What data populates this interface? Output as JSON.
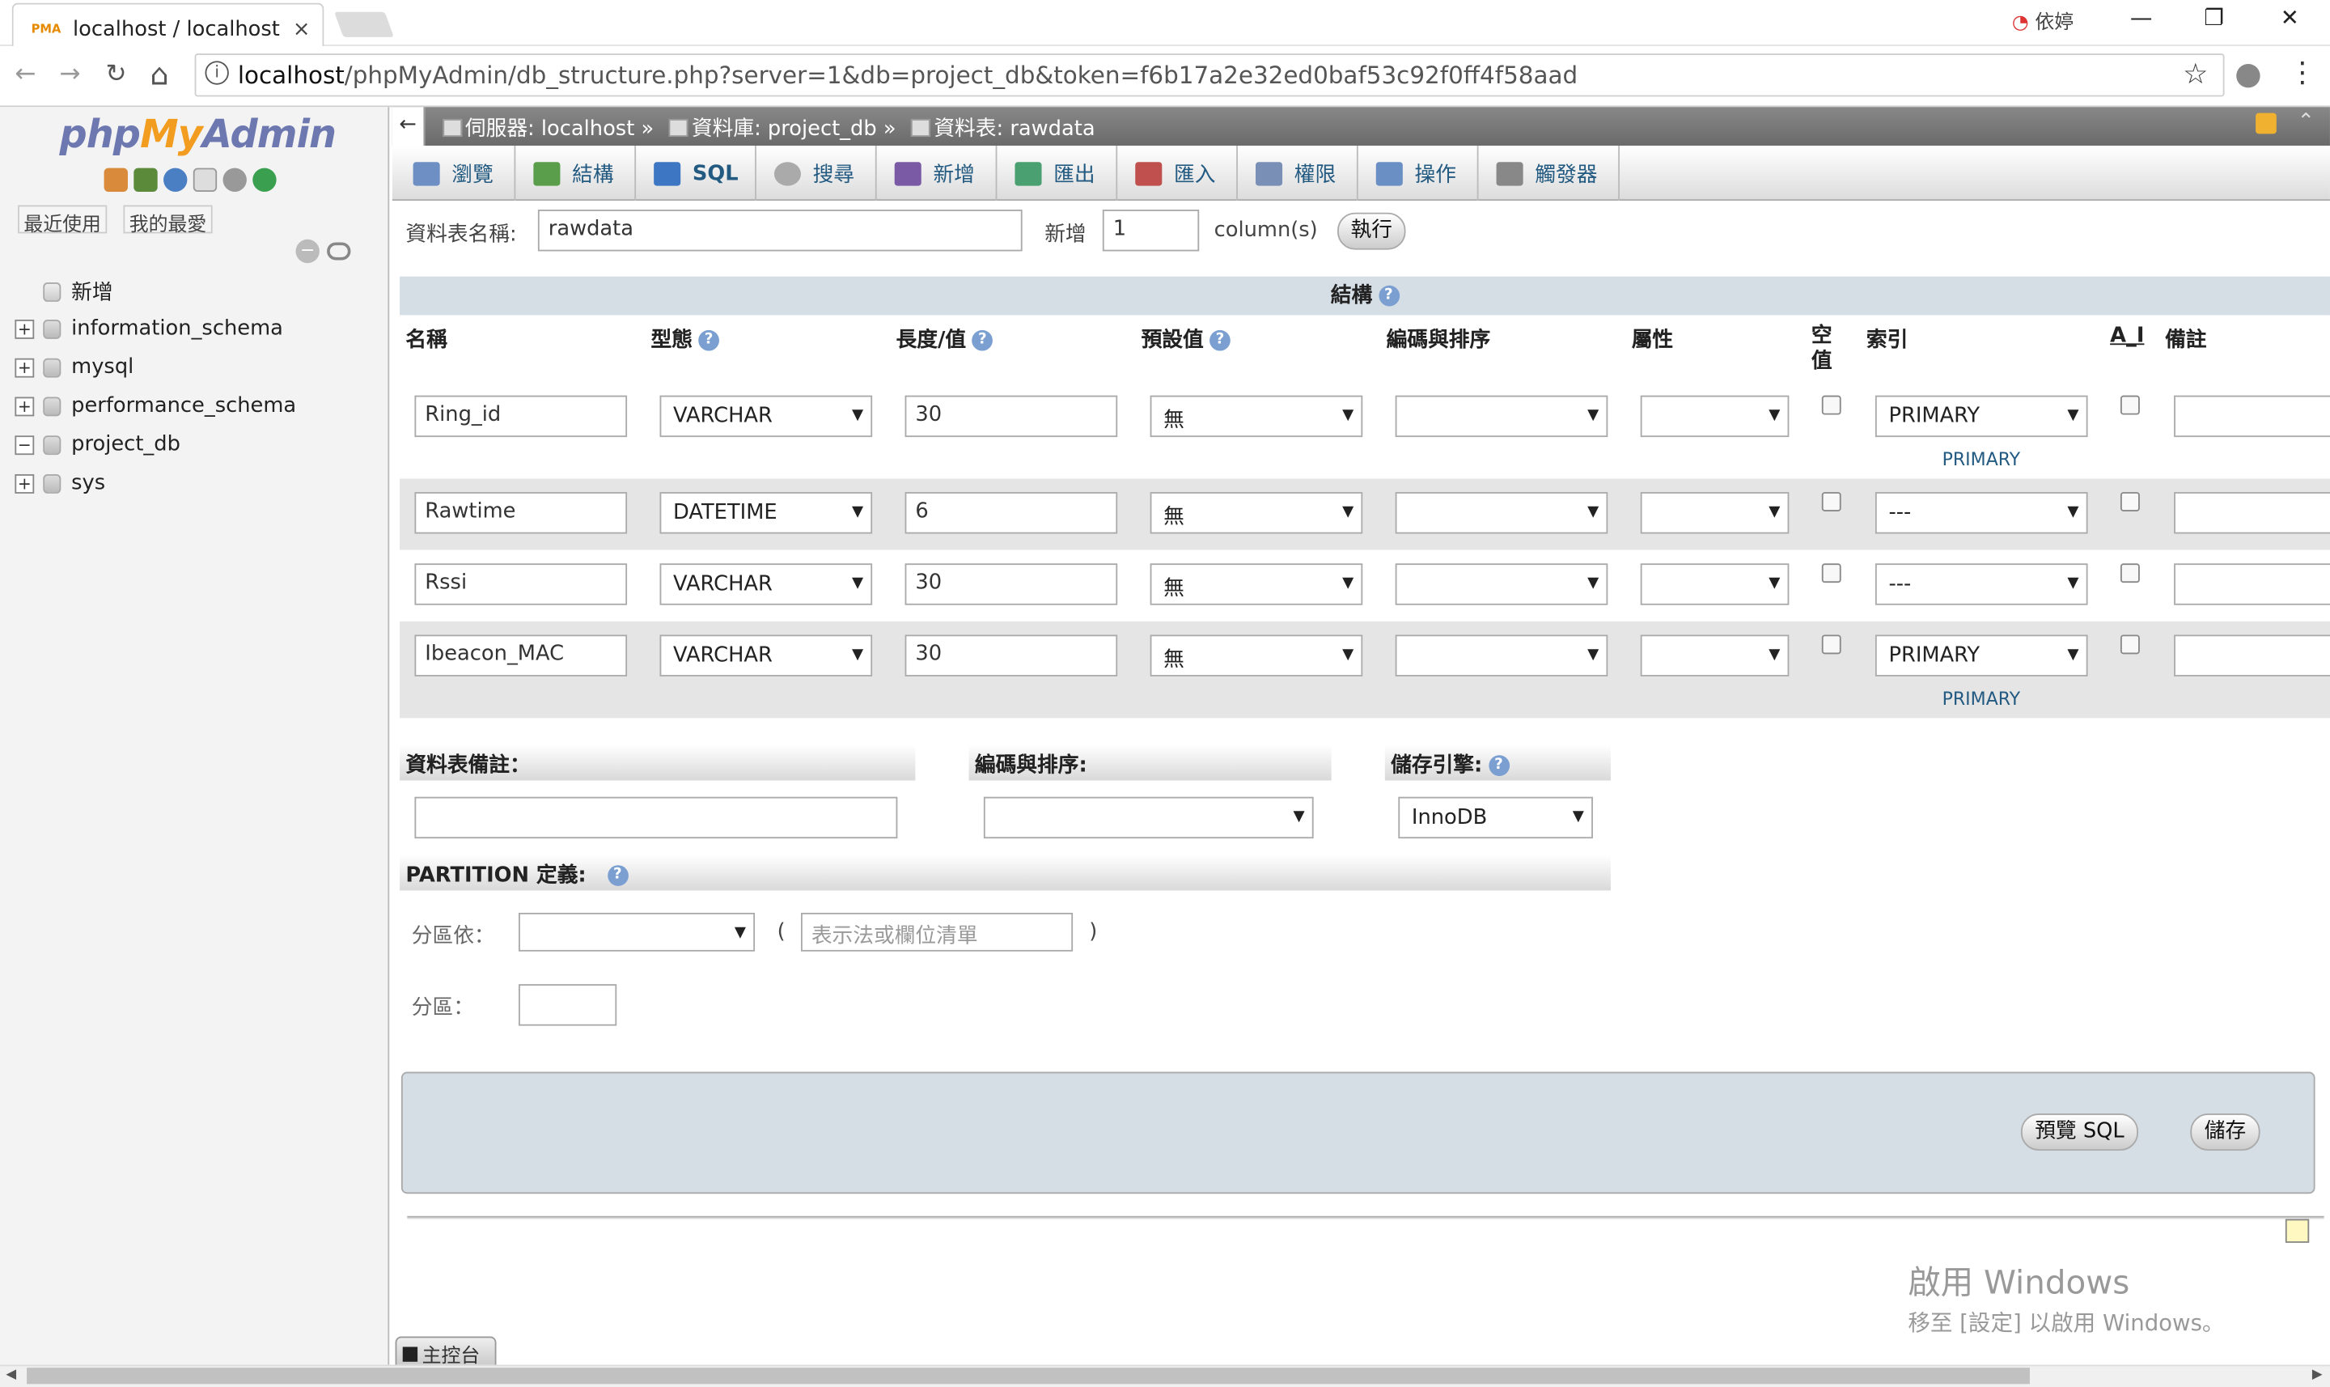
{
  "browser": {
    "tab_title": "localhost / localhost / p",
    "tab_favicon": "PMA",
    "close_glyph": "×",
    "user_name": "依婷",
    "url_host": "localhost",
    "url_path": "/phpMyAdmin/db_structure.php?server=1&db=project_db&token=f6b17a2e32ed0baf53c92f0ff4f58aad",
    "minimize": "—",
    "restore": "❐",
    "close": "✕",
    "back": "←",
    "forward": "→",
    "reload": "↻",
    "home": "⌂",
    "star": "☆",
    "menu": "⋮"
  },
  "sidebar": {
    "logo_php": "php",
    "logo_my": "My",
    "logo_admin": "Admin",
    "recent_label": "最近使用",
    "favorites_label": "我的最愛",
    "tree": [
      {
        "label": "新增",
        "expander": ""
      },
      {
        "label": "information_schema",
        "expander": "+"
      },
      {
        "label": "mysql",
        "expander": "+"
      },
      {
        "label": "performance_schema",
        "expander": "+"
      },
      {
        "label": "project_db",
        "expander": "−"
      },
      {
        "label": "sys",
        "expander": "+"
      }
    ]
  },
  "breadcrumb": {
    "back_glyph": "←",
    "server": "伺服器: localhost »",
    "database": "資料庫: project_db »",
    "table": "資料表: rawdata"
  },
  "menu_tabs": [
    {
      "label": "瀏覽",
      "color": "#6e8fc4"
    },
    {
      "label": "結構",
      "color": "#5a9d4a"
    },
    {
      "label": "SQL",
      "color": "#3d77c4"
    },
    {
      "label": "搜尋",
      "color": "#999"
    },
    {
      "label": "新增",
      "color": "#7a5aa5"
    },
    {
      "label": "匯出",
      "color": "#4aa070"
    },
    {
      "label": "匯入",
      "color": "#c0504d"
    },
    {
      "label": "權限",
      "color": "#7a8fb5"
    },
    {
      "label": "操作",
      "color": "#6a8fc5"
    },
    {
      "label": "觸發器",
      "color": "#888"
    }
  ],
  "form": {
    "table_name_label": "資料表名稱:",
    "table_name_value": "rawdata",
    "add_label": "新增",
    "add_count": "1",
    "columns_label": "column(s)",
    "go_button": "執行"
  },
  "structure": {
    "section_title": "結構",
    "headers": {
      "name": "名稱",
      "type": "型態",
      "length": "長度/值",
      "default": "預設值",
      "collation": "編碼與排序",
      "attributes": "屬性",
      "null": "空值",
      "index": "索引",
      "ai": "A_I",
      "comments": "備註"
    },
    "rows": [
      {
        "name": "Ring_id",
        "type": "VARCHAR",
        "length": "30",
        "default": "無",
        "index": "PRIMARY",
        "index_link": "PRIMARY"
      },
      {
        "name": "Rawtime",
        "type": "DATETIME",
        "length": "6",
        "default": "無",
        "index": "---",
        "index_link": ""
      },
      {
        "name": "Rssi",
        "type": "VARCHAR",
        "length": "30",
        "default": "無",
        "index": "---",
        "index_link": ""
      },
      {
        "name": "Ibeacon_MAC",
        "type": "VARCHAR",
        "length": "30",
        "default": "無",
        "index": "PRIMARY",
        "index_link": "PRIMARY"
      }
    ]
  },
  "table_options": {
    "comment_label": "資料表備註：",
    "collation_label": "編碼與排序:",
    "engine_label": "儲存引擎:",
    "engine_value": "InnoDB"
  },
  "partition": {
    "title": "PARTITION 定義:",
    "by_label": "分區依：",
    "open_paren": "(",
    "close_paren": ")",
    "expr_placeholder": "表示法或欄位清單",
    "partitions_label": "分區："
  },
  "footer": {
    "preview_sql": "預覽 SQL",
    "save": "儲存",
    "console_label": "主控台"
  },
  "watermark": {
    "line1": "啟用 Windows",
    "line2": "移至 [設定] 以啟用 Windows。"
  }
}
